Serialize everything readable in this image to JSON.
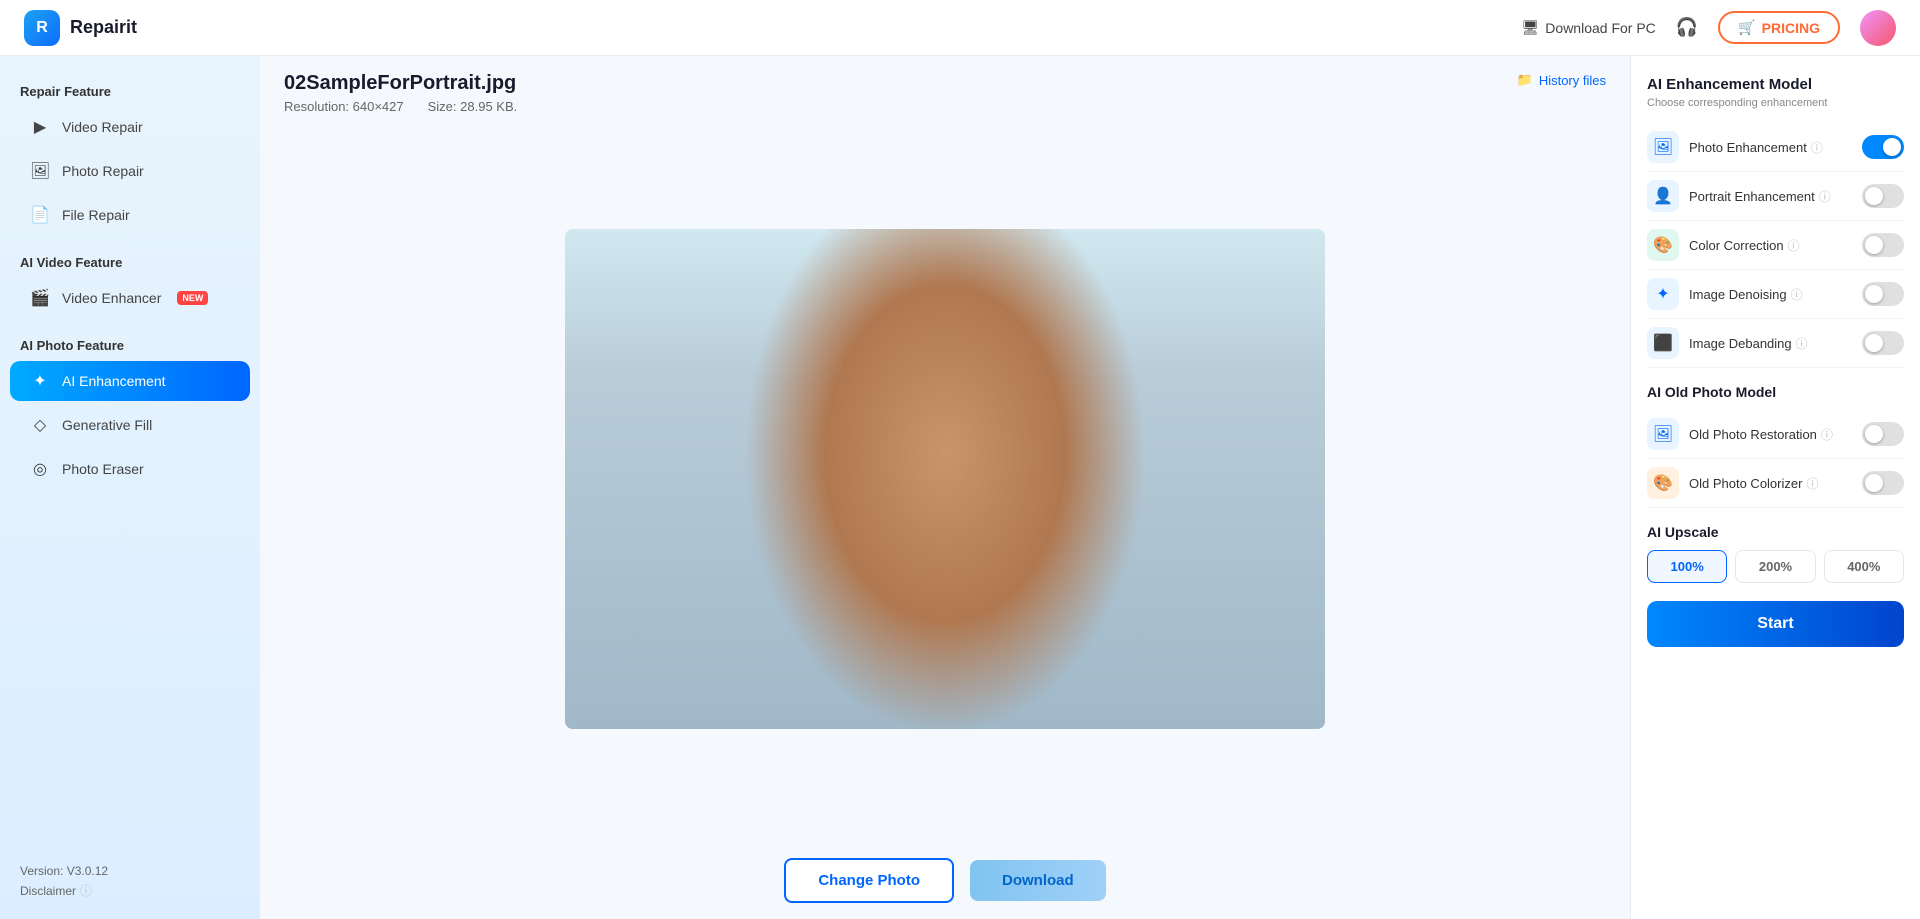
{
  "app": {
    "logo_letter": "R",
    "logo_name": "Repairit"
  },
  "topnav": {
    "download_pc": "Download For PC",
    "pricing": "PRICING",
    "cart_icon": "🛒"
  },
  "sidebar": {
    "repair_section": "Repair Feature",
    "items_repair": [
      {
        "id": "video-repair",
        "label": "Video Repair",
        "icon": "▶"
      },
      {
        "id": "photo-repair",
        "label": "Photo Repair",
        "icon": "🖼"
      },
      {
        "id": "file-repair",
        "label": "File Repair",
        "icon": "📄"
      }
    ],
    "ai_video_section": "AI Video Feature",
    "items_ai_video": [
      {
        "id": "video-enhancer",
        "label": "Video Enhancer",
        "icon": "🎬",
        "badge": "NEW"
      }
    ],
    "ai_photo_section": "AI Photo Feature",
    "items_ai_photo": [
      {
        "id": "ai-enhancement",
        "label": "AI Enhancement",
        "icon": "✦",
        "active": true
      },
      {
        "id": "generative-fill",
        "label": "Generative Fill",
        "icon": "◇"
      },
      {
        "id": "photo-eraser",
        "label": "Photo Eraser",
        "icon": "◎"
      }
    ],
    "version": "Version: V3.0.12",
    "disclaimer": "Disclaimer"
  },
  "file": {
    "name": "02SampleForPortrait.jpg",
    "resolution": "Resolution: 640×427",
    "size": "Size: 28.95 KB.",
    "history_files": "History files"
  },
  "bottom_toolbar": {
    "change_photo": "Change Photo",
    "download": "Download"
  },
  "right_panel": {
    "model_title": "AI Enhancement Model",
    "model_subtitle": "Choose corresponding enhancement",
    "features": [
      {
        "id": "photo-enhancement",
        "label": "Photo Enhancement",
        "icon": "🖼",
        "icon_class": "blue",
        "enabled": true
      },
      {
        "id": "portrait-enhancement",
        "label": "Portrait Enhancement",
        "icon": "👤",
        "icon_class": "blue",
        "enabled": false
      },
      {
        "id": "color-correction",
        "label": "Color Correction",
        "icon": "🎨",
        "icon_class": "teal",
        "enabled": false
      },
      {
        "id": "image-denoising",
        "label": "Image Denoising",
        "icon": "✦",
        "icon_class": "blue",
        "enabled": false
      },
      {
        "id": "image-debanding",
        "label": "Image Debanding",
        "icon": "⬛",
        "icon_class": "blue",
        "enabled": false
      }
    ],
    "old_photo_title": "AI Old Photo Model",
    "old_photo_features": [
      {
        "id": "old-photo-restoration",
        "label": "Old Photo Restoration",
        "icon": "🖼",
        "icon_class": "blue",
        "enabled": false
      },
      {
        "id": "old-photo-colorizer",
        "label": "Old Photo Colorizer",
        "icon": "🎨",
        "icon_class": "orange",
        "enabled": false
      }
    ],
    "upscale_title": "AI Upscale",
    "upscale_options": [
      {
        "id": "100",
        "label": "100%",
        "active": true
      },
      {
        "id": "200",
        "label": "200%",
        "active": false
      },
      {
        "id": "400",
        "label": "400%",
        "active": false
      }
    ],
    "start_button": "Start"
  }
}
